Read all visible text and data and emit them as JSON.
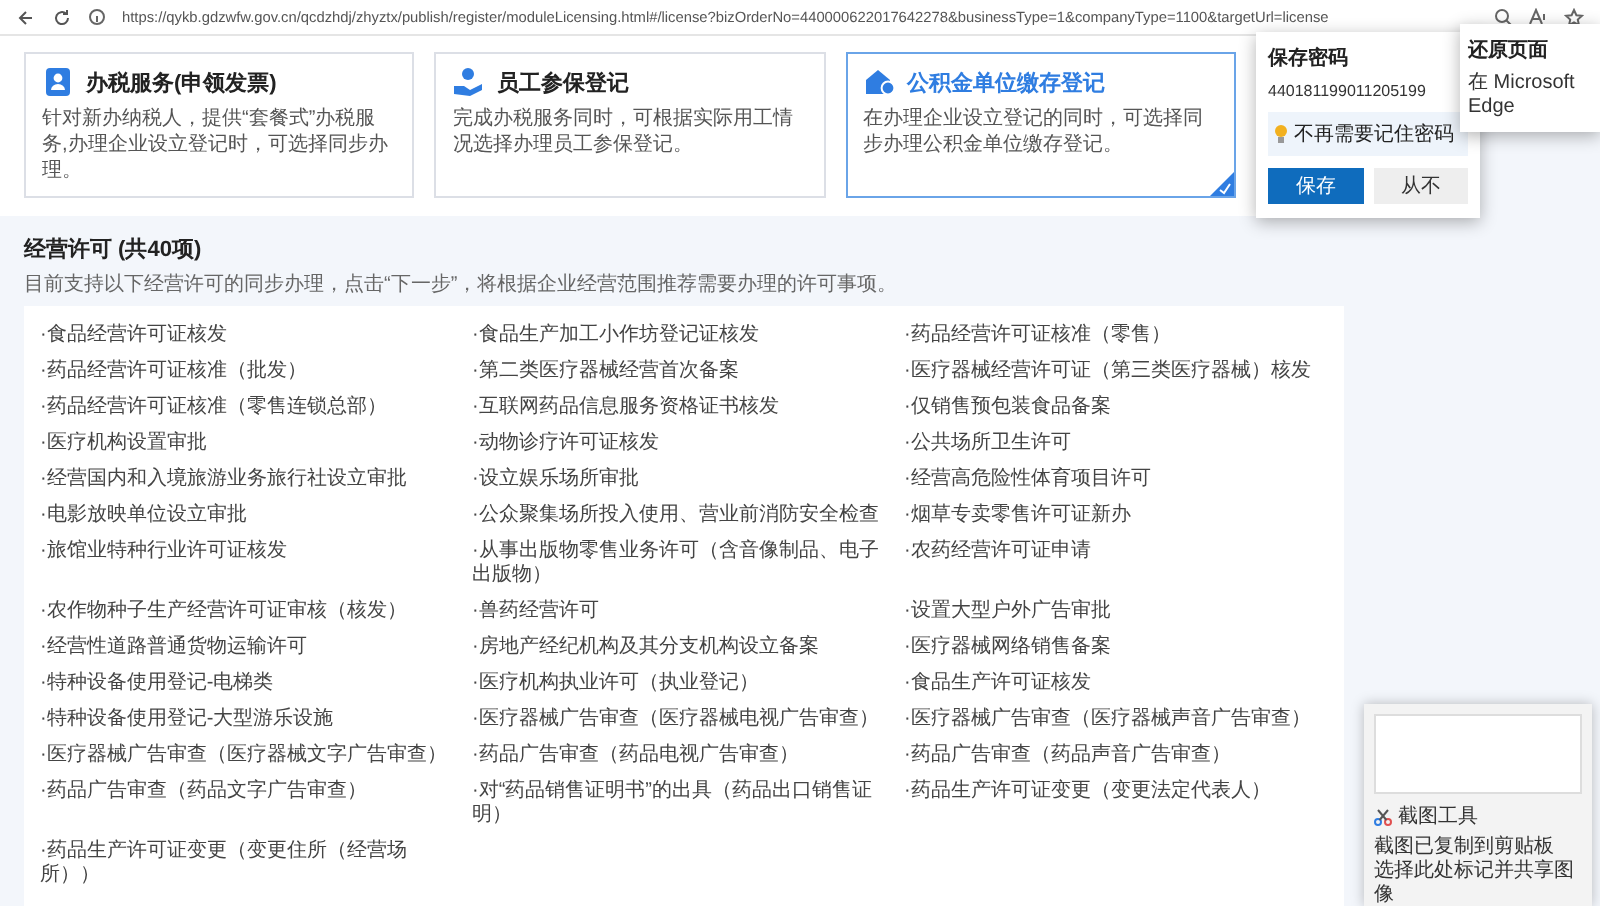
{
  "browser": {
    "url": "https://qykb.gdzwfw.gov.cn/qcdzhdj/zhyztx/publish/register/moduleLicensing.html#/license?bizOrderNo=440000622017642278&businessType=1&companyType=1100&targetUrl=license"
  },
  "services": [
    {
      "title": "办税服务(申领发票)",
      "description": "针对新办纳税人，提供“套餐式”办税服务,办理企业设立登记时，可选择同步办理。",
      "selected": false
    },
    {
      "title": "员工参保登记",
      "description": "完成办税服务同时，可根据实际用工情况选择办理员工参保登记。",
      "selected": false
    },
    {
      "title": "公积金单位缴存登记",
      "description": "在办理企业设立登记的同时，可选择同步办理公积金单位缴存登记。",
      "selected": true
    }
  ],
  "license_section": {
    "title": "经营许可 (共40项)",
    "description": "目前支持以下经营许可的同步办理，点击“下一步”，将根据企业经营范围推荐需要办理的许可事项。",
    "items": [
      "·食品经营许可证核发",
      "·食品生产加工小作坊登记证核发",
      "·药品经营许可证核准（零售）",
      "·药品经营许可证核准（批发）",
      "·第二类医疗器械经营首次备案",
      "·医疗器械经营许可证（第三类医疗器械）核发",
      "·药品经营许可证核准（零售连锁总部）",
      "·互联网药品信息服务资格证书核发",
      "·仅销售预包装食品备案",
      "·医疗机构设置审批",
      "·动物诊疗许可证核发",
      "·公共场所卫生许可",
      "·经营国内和入境旅游业务旅行社设立审批",
      "·设立娱乐场所审批",
      "·经营高危险性体育项目许可",
      "·电影放映单位设立审批",
      "·公众聚集场所投入使用、营业前消防安全检查",
      "·烟草专卖零售许可证新办",
      "·旅馆业特种行业许可证核发",
      "·从事出版物零售业务许可（含音像制品、电子出版物）",
      "·农药经营许可证申请",
      "·农作物种子生产经营许可证审核（核发）",
      "·兽药经营许可",
      "·设置大型户外广告审批",
      "·经营性道路普通货物运输许可",
      "·房地产经纪机构及其分支机构设立备案",
      "·医疗器械网络销售备案",
      "·特种设备使用登记-电梯类",
      "·医疗机构执业许可（执业登记）",
      "·食品生产许可证核发",
      "·特种设备使用登记-大型游乐设施",
      "·医疗器械广告审查（医疗器械电视广告审查）",
      "·医疗器械广告审查（医疗器械声音广告审查）",
      "·医疗器械广告审查（医疗器械文字广告审查）",
      "·药品广告审查（药品电视广告审查）",
      "·药品广告审查（药品声音广告审查）",
      "·药品广告审查（药品文字广告审查）",
      "·对“药品销售证明书”的出具（药品出口销售证明）",
      "·药品生产许可证变更（变更法定代表人）",
      "·药品生产许可证变更（变更住所（经营场所））"
    ]
  },
  "password_popup": {
    "title": "保存密码",
    "username": "440181199011205199",
    "hint": "不再需要记住密码",
    "buttons": [
      {
        "label": "保存",
        "kind": "primary"
      },
      {
        "label": "从不",
        "kind": "secondary"
      }
    ]
  },
  "restore_popup": {
    "title": "还原页面",
    "text": "在 Microsoft Edge"
  },
  "snip_notification": {
    "app": "截图工具",
    "message": "截图已复制到剪贴板",
    "action": "选择此处标记并共享图像"
  }
}
